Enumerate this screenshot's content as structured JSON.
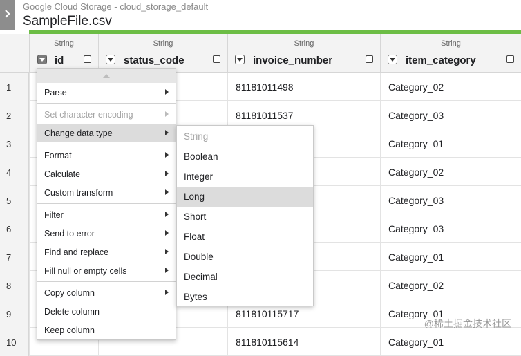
{
  "header": {
    "breadcrumb": "Google Cloud Storage - cloud_storage_default",
    "filename": "SampleFile.csv"
  },
  "columns": [
    {
      "type": "String",
      "name": "id"
    },
    {
      "type": "String",
      "name": "status_code"
    },
    {
      "type": "String",
      "name": "invoice_number"
    },
    {
      "type": "String",
      "name": "item_category"
    }
  ],
  "rows": [
    {
      "num": "1",
      "id": "",
      "status_code": "",
      "invoice_number": "81181011498",
      "item_category": "Category_02"
    },
    {
      "num": "2",
      "id": "",
      "status_code": "",
      "invoice_number": "81181011537",
      "item_category": "Category_03"
    },
    {
      "num": "3",
      "id": "",
      "status_code": "",
      "invoice_number": "",
      "item_category": "Category_01"
    },
    {
      "num": "4",
      "id": "",
      "status_code": "",
      "invoice_number": "",
      "item_category": "Category_02"
    },
    {
      "num": "5",
      "id": "",
      "status_code": "",
      "invoice_number": "",
      "item_category": "Category_03"
    },
    {
      "num": "6",
      "id": "",
      "status_code": "",
      "invoice_number": "",
      "item_category": "Category_03"
    },
    {
      "num": "7",
      "id": "",
      "status_code": "",
      "invoice_number": "",
      "item_category": "Category_01"
    },
    {
      "num": "8",
      "id": "",
      "status_code": "",
      "invoice_number": "",
      "item_category": "Category_02"
    },
    {
      "num": "9",
      "id": "",
      "status_code": "",
      "invoice_number": "811810115717",
      "item_category": "Category_01"
    },
    {
      "num": "10",
      "id": "",
      "status_code": "",
      "invoice_number": "811810115614",
      "item_category": "Category_01"
    }
  ],
  "context_menu": {
    "groups": [
      [
        {
          "label": "Parse",
          "submenu": true,
          "disabled": false
        },
        {
          "label": "Set character encoding",
          "submenu": true,
          "disabled": true
        },
        {
          "label": "Change data type",
          "submenu": true,
          "disabled": false,
          "highlighted": true
        }
      ],
      [
        {
          "label": "Format",
          "submenu": true,
          "disabled": false
        },
        {
          "label": "Calculate",
          "submenu": true,
          "disabled": false
        },
        {
          "label": "Custom transform",
          "submenu": true,
          "disabled": false
        }
      ],
      [
        {
          "label": "Filter",
          "submenu": true,
          "disabled": false
        },
        {
          "label": "Send to error",
          "submenu": true,
          "disabled": false
        },
        {
          "label": "Find and replace",
          "submenu": true,
          "disabled": false
        },
        {
          "label": "Fill null or empty cells",
          "submenu": true,
          "disabled": false
        }
      ],
      [
        {
          "label": "Copy column",
          "submenu": true,
          "disabled": false
        },
        {
          "label": "Delete column",
          "submenu": false,
          "disabled": false
        },
        {
          "label": "Keep column",
          "submenu": false,
          "disabled": false
        }
      ]
    ]
  },
  "data_type_submenu": [
    {
      "label": "String",
      "disabled": true
    },
    {
      "label": "Boolean"
    },
    {
      "label": "Integer"
    },
    {
      "label": "Long",
      "highlighted": true
    },
    {
      "label": "Short"
    },
    {
      "label": "Float"
    },
    {
      "label": "Double"
    },
    {
      "label": "Decimal"
    },
    {
      "label": "Bytes"
    }
  ],
  "watermark": "@稀土掘金技术社区",
  "colors": {
    "accent_bar": "#6cbd45",
    "expand_button": "#8d8d8d"
  }
}
